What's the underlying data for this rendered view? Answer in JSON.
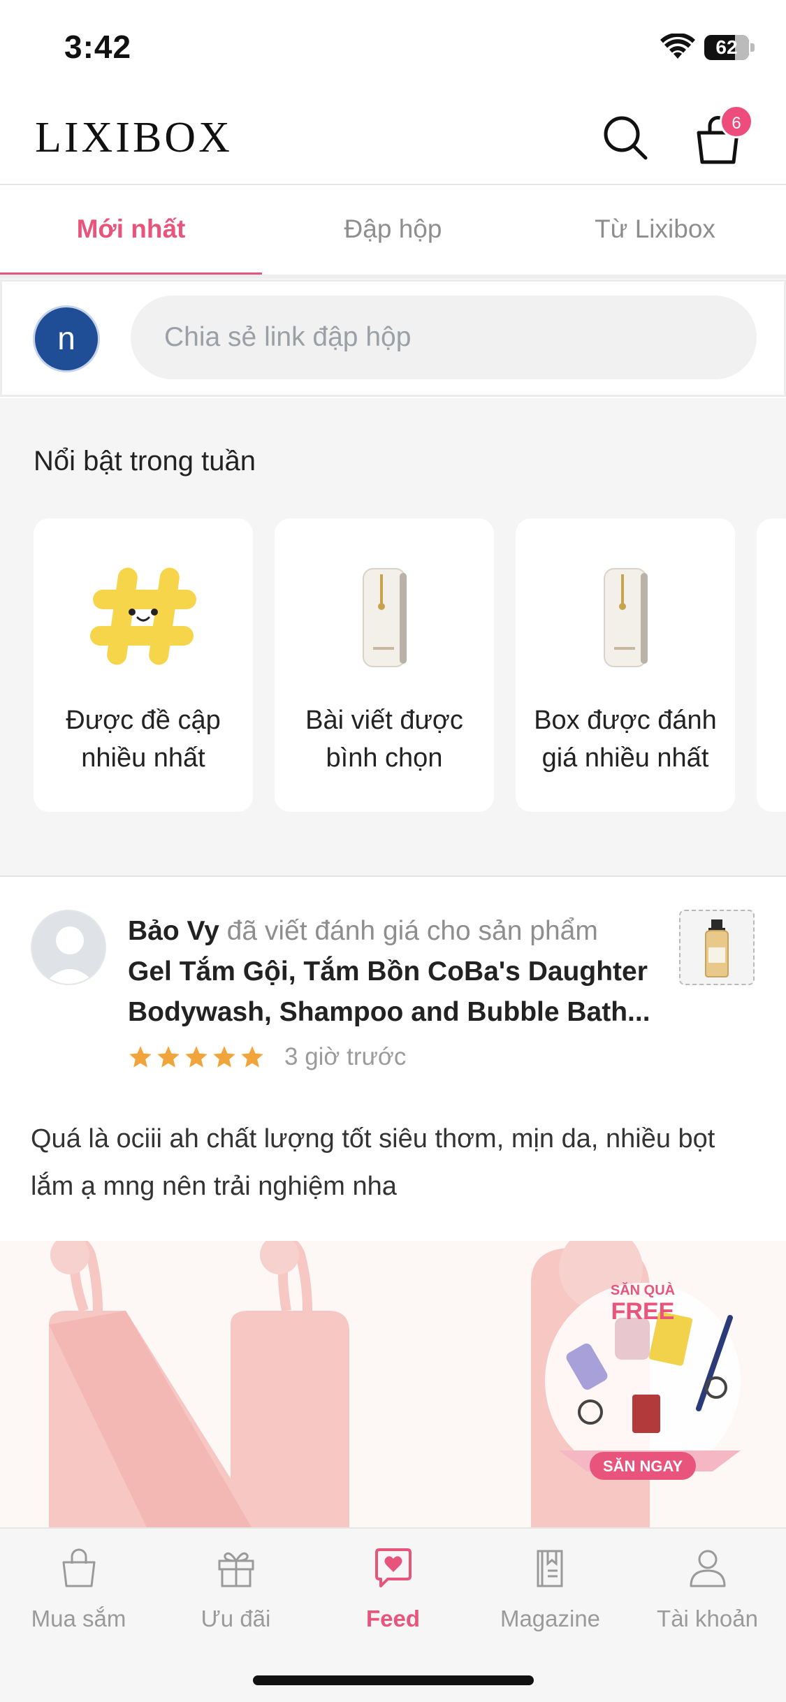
{
  "status": {
    "time": "3:42",
    "battery": "62"
  },
  "header": {
    "logo": "LIXIBOX",
    "cart_count": "6"
  },
  "tabs": [
    {
      "label": "Mới nhất",
      "active": true
    },
    {
      "label": "Đập hộp",
      "active": false
    },
    {
      "label": "Từ Lixibox",
      "active": false
    }
  ],
  "compose": {
    "avatar_letter": "n",
    "placeholder": "Chia sẻ link đập hộp"
  },
  "featured": {
    "title": "Nổi bật trong tuần",
    "cards": [
      {
        "label": "Được đề cập nhiều nhất",
        "icon": "hashtag-icon"
      },
      {
        "label": "Bài viết được bình chọn",
        "icon": "product-bottle-icon"
      },
      {
        "label": "Box được đánh giá nhiều nhất",
        "icon": "product-bottle-icon"
      }
    ]
  },
  "post": {
    "author": "Bảo Vy",
    "action": "đã viết đánh giá cho sản phẩm",
    "product": "Gel Tắm Gội, Tắm Bồn CoBa's Daughter Bodywash, Shampoo and Bubble Bath...",
    "rating": 5,
    "time": "3 giờ trước",
    "body": "Quá là ociii ah chất lượng tốt siêu thơm, mịn da, nhiều bọt lắm ạ mng nên trải nghiệm nha",
    "image_text": {
      "promo_small": "SĂN QUÀ",
      "promo_big": "FREE",
      "cta": "SĂN NGAY"
    }
  },
  "nav": [
    {
      "label": "Mua sắm",
      "icon": "shopping-bag-icon",
      "active": false
    },
    {
      "label": "Ưu đãi",
      "icon": "gift-icon",
      "active": false
    },
    {
      "label": "Feed",
      "icon": "feed-heart-icon",
      "active": true
    },
    {
      "label": "Magazine",
      "icon": "magazine-icon",
      "active": false
    },
    {
      "label": "Tài khoản",
      "icon": "account-icon",
      "active": false
    }
  ],
  "colors": {
    "accent": "#e8547c",
    "avatar": "#1f4e96",
    "star": "#f0a43a"
  }
}
